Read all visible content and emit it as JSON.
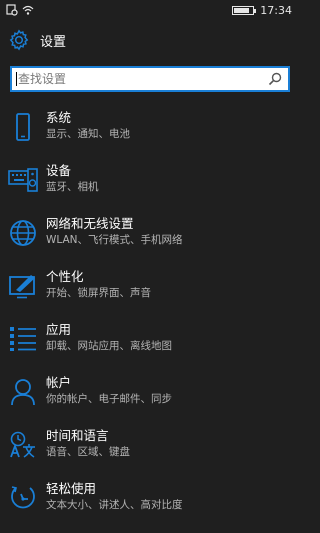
{
  "status_bar": {
    "time": "17:34",
    "battery_level": 0.85
  },
  "header": {
    "title": "设置",
    "icon": "gear-icon"
  },
  "search": {
    "placeholder": "查找设置",
    "value": "",
    "icon": "search-icon"
  },
  "colors": {
    "accent": "#1a7fd6",
    "background": "#1f1f1f",
    "subtext": "#b4b4b4"
  },
  "items": [
    {
      "label": "系统",
      "sub": "显示、通知、电池",
      "icon": "phone-icon"
    },
    {
      "label": "设备",
      "sub": "蓝牙、相机",
      "icon": "keyboard-speaker-icon"
    },
    {
      "label": "网络和无线设置",
      "sub": "WLAN、飞行模式、手机网络",
      "icon": "globe-icon"
    },
    {
      "label": "个性化",
      "sub": "开始、锁屏界面、声音",
      "icon": "paint-screen-icon"
    },
    {
      "label": "应用",
      "sub": "卸载、网站应用、离线地图",
      "icon": "app-list-icon"
    },
    {
      "label": "帐户",
      "sub": "你的帐户、电子邮件、同步",
      "icon": "person-icon"
    },
    {
      "label": "时间和语言",
      "sub": "语音、区域、键盘",
      "icon": "time-language-icon"
    },
    {
      "label": "轻松使用",
      "sub": "文本大小、讲述人、高对比度",
      "icon": "ease-of-access-icon"
    }
  ]
}
